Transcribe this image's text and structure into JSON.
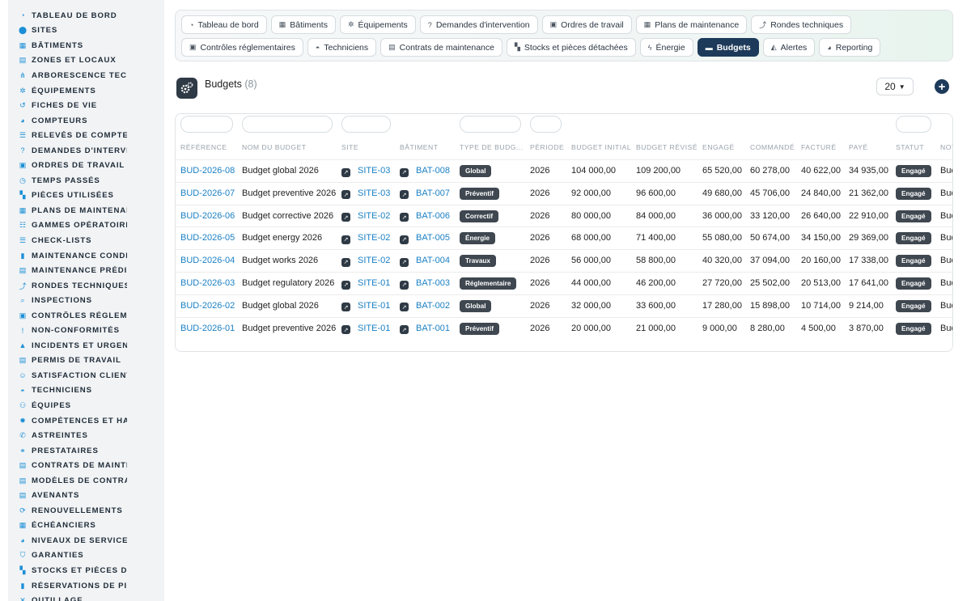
{
  "sidebar": {
    "items": [
      {
        "label": "TABLEAU DE BORD",
        "icon": "dashboard-icon",
        "glyph": "◔"
      },
      {
        "label": "SITES",
        "icon": "location-pin-icon",
        "glyph": "⬤"
      },
      {
        "label": "BÂTIMENTS",
        "icon": "building-icon",
        "glyph": "▦"
      },
      {
        "label": "ZONES ET LOCAUX",
        "icon": "grid-icon",
        "glyph": "▤"
      },
      {
        "label": "ARBORESCENCE TECHNIQUE",
        "icon": "sitemap-icon",
        "glyph": "⋔"
      },
      {
        "label": "ÉQUIPEMENTS",
        "icon": "cogs-icon",
        "glyph": "✲"
      },
      {
        "label": "FICHES DE VIE",
        "icon": "history-icon",
        "glyph": "↺"
      },
      {
        "label": "COMPTEURS",
        "icon": "gauge-icon",
        "glyph": "◕"
      },
      {
        "label": "RELEVÉS DE COMPTEURS",
        "icon": "list-icon",
        "glyph": "☰"
      },
      {
        "label": "DEMANDES D'INTERVENTION",
        "icon": "question-circle-icon",
        "glyph": "?"
      },
      {
        "label": "ORDRES DE TRAVAIL",
        "icon": "clipboard-icon",
        "glyph": "▣"
      },
      {
        "label": "TEMPS PASSÉS",
        "icon": "clock-icon",
        "glyph": "◷"
      },
      {
        "label": "PIÈCES UTILISÉES",
        "icon": "cubes-icon",
        "glyph": "▚"
      },
      {
        "label": "PLANS DE MAINTENANCE",
        "icon": "calendar-icon",
        "glyph": "▦"
      },
      {
        "label": "GAMMES OPÉRATOIRES",
        "icon": "tasks-icon",
        "glyph": "☷"
      },
      {
        "label": "CHECK-LISTS",
        "icon": "checklist-icon",
        "glyph": "☰"
      },
      {
        "label": "MAINTENANCE CONDITIONNELLE",
        "icon": "thermometer-icon",
        "glyph": "▮"
      },
      {
        "label": "MAINTENANCE PRÉDICTIVE",
        "icon": "chart-line-icon",
        "glyph": "▤"
      },
      {
        "label": "RONDES TECHNIQUES",
        "icon": "route-icon",
        "glyph": "⤴"
      },
      {
        "label": "INSPECTIONS",
        "icon": "search-icon",
        "glyph": "⌕"
      },
      {
        "label": "CONTRÔLES RÉGLEMENTAIRES",
        "icon": "clipboard-check-icon",
        "glyph": "▣"
      },
      {
        "label": "NON-CONFORMITÉS",
        "icon": "exclamation-circle-icon",
        "glyph": "!"
      },
      {
        "label": "INCIDENTS ET URGENCES",
        "icon": "warning-icon",
        "glyph": "▲"
      },
      {
        "label": "PERMIS DE TRAVAIL",
        "icon": "id-card-icon",
        "glyph": "▤"
      },
      {
        "label": "SATISFACTION CLIENT",
        "icon": "smile-icon",
        "glyph": "☺"
      },
      {
        "label": "TECHNICIENS",
        "icon": "hard-hat-icon",
        "glyph": "◓"
      },
      {
        "label": "ÉQUIPES",
        "icon": "users-icon",
        "glyph": "⚇"
      },
      {
        "label": "COMPÉTENCES ET HABILITATIONS",
        "icon": "certificate-icon",
        "glyph": "✹"
      },
      {
        "label": "ASTREINTES",
        "icon": "phone-icon",
        "glyph": "✆"
      },
      {
        "label": "PRESTATAIRES",
        "icon": "handshake-icon",
        "glyph": "⚭"
      },
      {
        "label": "CONTRATS DE MAINTENANCE",
        "icon": "file-contract-icon",
        "glyph": "▤"
      },
      {
        "label": "MODÈLES DE CONTRATS",
        "icon": "file-alt-icon",
        "glyph": "▤"
      },
      {
        "label": "AVENANTS",
        "icon": "file-signature-icon",
        "glyph": "▤"
      },
      {
        "label": "RENOUVELLEMENTS",
        "icon": "sync-icon",
        "glyph": "⟳"
      },
      {
        "label": "ÉCHÉANCIERS",
        "icon": "calendar-alt-icon",
        "glyph": "▦"
      },
      {
        "label": "NIVEAUX DE SERVICE (SLA)",
        "icon": "tachometer-icon",
        "glyph": "◕"
      },
      {
        "label": "GARANTIES",
        "icon": "shield-icon",
        "glyph": "⛉"
      },
      {
        "label": "STOCKS ET PIÈCES DÉTACHÉES",
        "icon": "boxes-icon",
        "glyph": "▚"
      },
      {
        "label": "RÉSERVATIONS DE PIÈCES",
        "icon": "bookmark-icon",
        "glyph": "▮"
      },
      {
        "label": "OUTILLAGE",
        "icon": "tools-icon",
        "glyph": "✕"
      }
    ]
  },
  "topnav": {
    "row1": [
      {
        "label": "Tableau de bord",
        "icon": "dashboard-icon",
        "glyph": "◔",
        "active": false
      },
      {
        "label": "Bâtiments",
        "icon": "building-icon",
        "glyph": "▦",
        "active": false
      },
      {
        "label": "Équipements",
        "icon": "cogs-icon",
        "glyph": "✲",
        "active": false
      },
      {
        "label": "Demandes d'intervention",
        "icon": "question-circle-icon",
        "glyph": "?",
        "active": false
      },
      {
        "label": "Ordres de travail",
        "icon": "clipboard-icon",
        "glyph": "▣",
        "active": false
      },
      {
        "label": "Plans de maintenance",
        "icon": "calendar-icon",
        "glyph": "▦",
        "active": false
      },
      {
        "label": "Rondes techniques",
        "icon": "route-icon",
        "glyph": "⤴",
        "active": false
      }
    ],
    "row2": [
      {
        "label": "Contrôles réglementaires",
        "icon": "clipboard-check-icon",
        "glyph": "▣",
        "active": false
      },
      {
        "label": "Techniciens",
        "icon": "hard-hat-icon",
        "glyph": "◓",
        "active": false
      },
      {
        "label": "Contrats de maintenance",
        "icon": "file-contract-icon",
        "glyph": "▤",
        "active": false
      },
      {
        "label": "Stocks et pièces détachées",
        "icon": "boxes-icon",
        "glyph": "▚",
        "active": false
      },
      {
        "label": "Énergie",
        "icon": "bolt-icon",
        "glyph": "ϟ",
        "active": false
      },
      {
        "label": "Budgets",
        "icon": "money-bill-icon",
        "glyph": "▬",
        "active": true
      },
      {
        "label": "Alertes",
        "icon": "bell-icon",
        "glyph": "◭",
        "active": false
      },
      {
        "label": "Reporting",
        "icon": "chart-pie-icon",
        "glyph": "◕",
        "active": false
      }
    ]
  },
  "header": {
    "title": "Budgets",
    "count": "(8)",
    "per_page": "20",
    "add_symbol": "+"
  },
  "table": {
    "columns": [
      "RÉFÉRENCE",
      "NOM DU BUDGET",
      "SITE",
      "BÂTIMENT",
      "TYPE DE BUDG...",
      "PÉRIODE",
      "BUDGET INITIAL",
      "BUDGET RÉVISÉ",
      "ENGAGÉ",
      "COMMANDÉ",
      "FACTURÉ",
      "PAYÉ",
      "STATUT",
      "NOT"
    ],
    "rows": [
      {
        "ref": "BUD-2026-08",
        "name": "Budget global 2026",
        "site": "SITE-03",
        "building": "BAT-008",
        "type": "Global",
        "period": "2026",
        "initial": "104 000,00",
        "revised": "109 200,00",
        "engaged": "65 520,00",
        "ordered": "60 278,00",
        "invoiced": "40 622,00",
        "paid": "34 935,00",
        "status": "Engagé",
        "note": "Bud"
      },
      {
        "ref": "BUD-2026-07",
        "name": "Budget preventive 2026",
        "site": "SITE-03",
        "building": "BAT-007",
        "type": "Préventif",
        "period": "2026",
        "initial": "92 000,00",
        "revised": "96 600,00",
        "engaged": "49 680,00",
        "ordered": "45 706,00",
        "invoiced": "24 840,00",
        "paid": "21 362,00",
        "status": "Engagé",
        "note": "Bud"
      },
      {
        "ref": "BUD-2026-06",
        "name": "Budget corrective 2026",
        "site": "SITE-02",
        "building": "BAT-006",
        "type": "Correctif",
        "period": "2026",
        "initial": "80 000,00",
        "revised": "84 000,00",
        "engaged": "36 000,00",
        "ordered": "33 120,00",
        "invoiced": "26 640,00",
        "paid": "22 910,00",
        "status": "Engagé",
        "note": "Bud"
      },
      {
        "ref": "BUD-2026-05",
        "name": "Budget energy 2026",
        "site": "SITE-02",
        "building": "BAT-005",
        "type": "Énergie",
        "period": "2026",
        "initial": "68 000,00",
        "revised": "71 400,00",
        "engaged": "55 080,00",
        "ordered": "50 674,00",
        "invoiced": "34 150,00",
        "paid": "29 369,00",
        "status": "Engagé",
        "note": "Bud"
      },
      {
        "ref": "BUD-2026-04",
        "name": "Budget works 2026",
        "site": "SITE-02",
        "building": "BAT-004",
        "type": "Travaux",
        "period": "2026",
        "initial": "56 000,00",
        "revised": "58 800,00",
        "engaged": "40 320,00",
        "ordered": "37 094,00",
        "invoiced": "20 160,00",
        "paid": "17 338,00",
        "status": "Engagé",
        "note": "Bud"
      },
      {
        "ref": "BUD-2026-03",
        "name": "Budget regulatory 2026",
        "site": "SITE-01",
        "building": "BAT-003",
        "type": "Réglementaire",
        "period": "2026",
        "initial": "44 000,00",
        "revised": "46 200,00",
        "engaged": "27 720,00",
        "ordered": "25 502,00",
        "invoiced": "20 513,00",
        "paid": "17 641,00",
        "status": "Engagé",
        "note": "Bud"
      },
      {
        "ref": "BUD-2026-02",
        "name": "Budget global 2026",
        "site": "SITE-01",
        "building": "BAT-002",
        "type": "Global",
        "period": "2026",
        "initial": "32 000,00",
        "revised": "33 600,00",
        "engaged": "17 280,00",
        "ordered": "15 898,00",
        "invoiced": "10 714,00",
        "paid": "9 214,00",
        "status": "Engagé",
        "note": "Bud"
      },
      {
        "ref": "BUD-2026-01",
        "name": "Budget preventive 2026",
        "site": "SITE-01",
        "building": "BAT-001",
        "type": "Préventif",
        "period": "2026",
        "initial": "20 000,00",
        "revised": "21 000,00",
        "engaged": "9 000,00",
        "ordered": "8 280,00",
        "invoiced": "4 500,00",
        "paid": "3 870,00",
        "status": "Engagé",
        "note": "Bud"
      }
    ]
  },
  "colors": {
    "accent": "#1d3a5a",
    "link": "#1b80c4",
    "badge": "#3f4750",
    "sidebar_icon": "#1b8fd6"
  }
}
